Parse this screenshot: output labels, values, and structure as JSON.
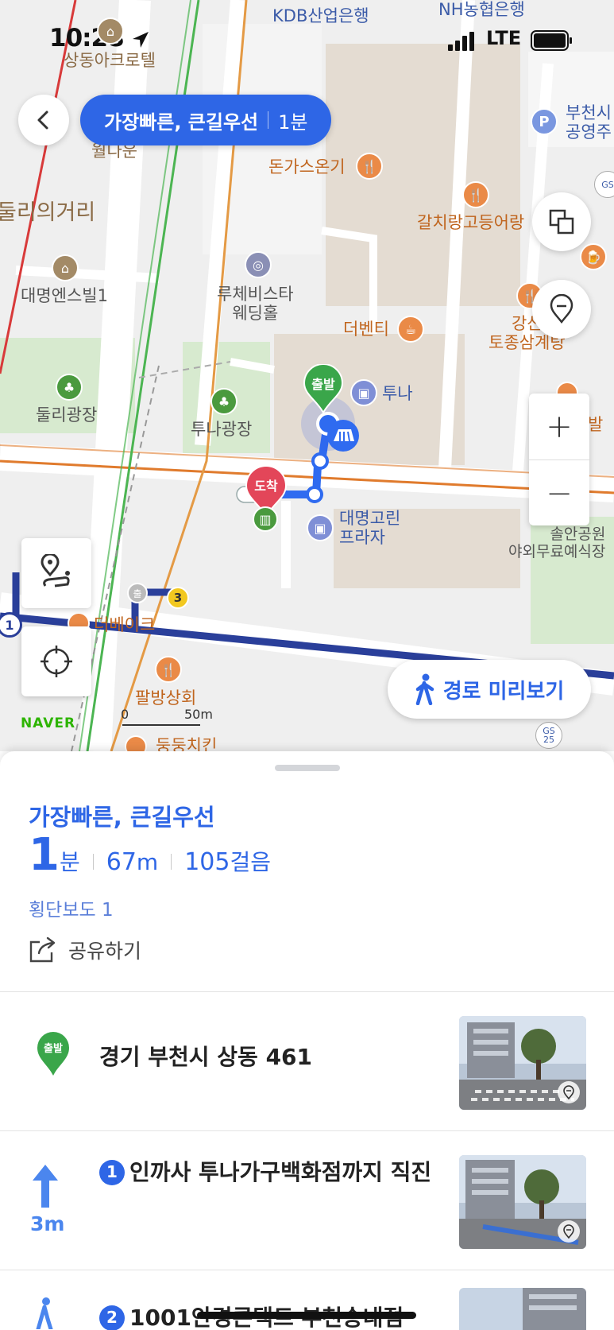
{
  "status_bar": {
    "time": "10:28",
    "network": "LTE"
  },
  "route_pill": {
    "title": "가장빠른, 큰길우선",
    "duration": "1분"
  },
  "map": {
    "labels": {
      "kdb": "KDB산업은행",
      "nh": "NH농협은행",
      "sangdong_acro": "상동아크로텔",
      "partial_top": "월다운",
      "dulli_street": "둘리의거리",
      "daemyung_ensville": "대명엔스빌1",
      "dulli_square": "둘리광장",
      "luce_bista": "루체비스타\n웨딩홀",
      "tuna_square": "투나광장",
      "dongas": "돈가스온기",
      "galchi": "갈치랑고등어랑",
      "the_venti": "더벤티",
      "tuna": "투나",
      "gangsan": "강산\n토종삼계탕",
      "daemyung_green": "대명고린\n프라자",
      "solan_park": "솔안공원\n야외무료예식장",
      "parking_public": "부천시\n공영주",
      "the_bake": "더베이크",
      "palbang": "팔방상회",
      "dungdung": "둥둥치킨",
      "gs25": "GS\n25",
      "start_pin": "출발",
      "end_pin": "도착",
      "bus_number": "3",
      "line_number": "1",
      "right_edge": "발"
    },
    "scale": {
      "zero": "0",
      "fifty": "50m"
    },
    "naver": "NAVER",
    "preview_button": "경로 미리보기"
  },
  "sheet": {
    "title": "가장빠른, 큰길우선",
    "duration_num": "1",
    "duration_unit": "분",
    "distance_num": "67",
    "distance_unit": "m",
    "steps_num": "105",
    "steps_unit": "걸음",
    "crosswalk": "횡단보도 1",
    "share": "공유하기",
    "steps": [
      {
        "badge": "출발",
        "text": "경기 부천시 상동 461"
      },
      {
        "number": "1",
        "text": "인까사 투나가구백화점까지 직진",
        "distance": "3m"
      },
      {
        "number": "2",
        "text": "1001안경콘택트 부천송내점"
      }
    ]
  },
  "colors": {
    "accent": "#2e66e6",
    "start_green": "#3aa64a",
    "end_red": "#e34659",
    "route_blue": "#2a3f9a"
  }
}
